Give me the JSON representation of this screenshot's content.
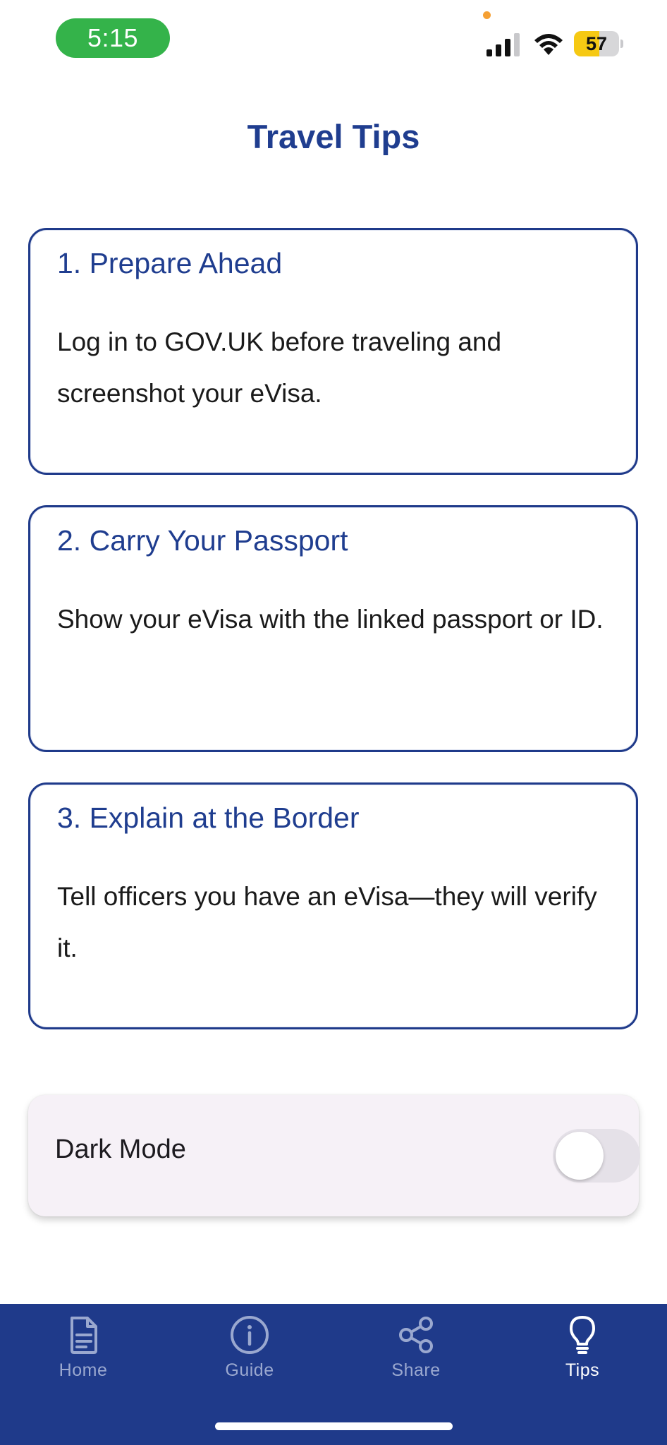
{
  "status_bar": {
    "time": "5:15",
    "battery_level": "57",
    "battery_fraction": 0.57,
    "icons": [
      "signal-icon",
      "wifi-icon",
      "battery-icon"
    ]
  },
  "page": {
    "title": "Travel Tips"
  },
  "tips": [
    {
      "title": "1. Prepare Ahead",
      "body": "Log in to GOV.UK before traveling and screenshot your eVisa."
    },
    {
      "title": "2. Carry Your Passport",
      "body": "Show your eVisa with the linked passport or ID."
    },
    {
      "title": "3. Explain at the Border",
      "body": "Tell officers you have an eVisa—they will verify it."
    }
  ],
  "settings": {
    "dark_mode_label": "Dark Mode",
    "dark_mode_enabled": false
  },
  "tab_bar": {
    "active": "Tips",
    "tabs": [
      {
        "label": "Home",
        "icon": "document-icon"
      },
      {
        "label": "Guide",
        "icon": "info-icon"
      },
      {
        "label": "Share",
        "icon": "share-icon"
      },
      {
        "label": "Tips",
        "icon": "lightbulb-icon"
      }
    ]
  },
  "colors": {
    "brand_navy": "#1f3a8a",
    "title_blue": "#1f3d8f",
    "status_green": "#34b34a",
    "battery_yellow": "#f6c913"
  }
}
